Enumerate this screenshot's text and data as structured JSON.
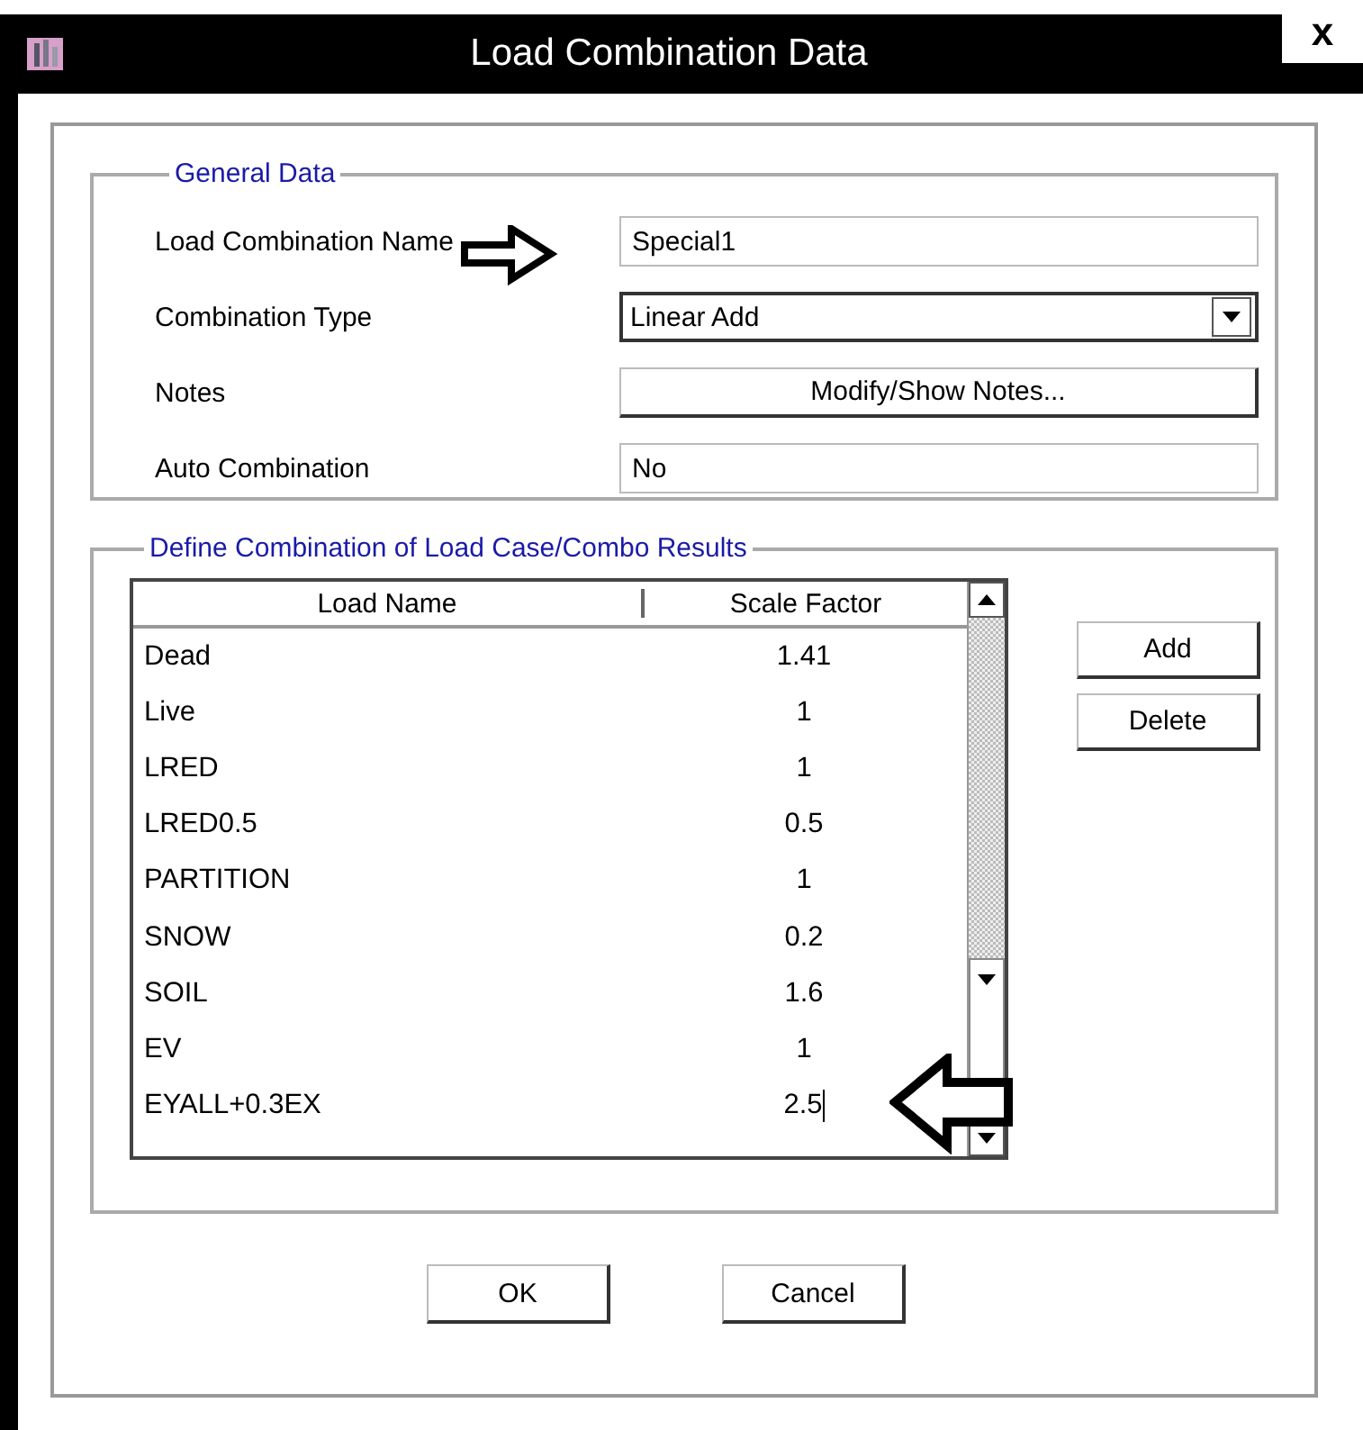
{
  "window": {
    "title": "Load Combination Data",
    "close": "x"
  },
  "general_data": {
    "legend": "General Data",
    "fields": [
      {
        "kind": "text",
        "label": "Load Combination Name",
        "value": "Special1",
        "annotated": true
      },
      {
        "kind": "dropdown",
        "label": "Combination Type",
        "value": "Linear Add",
        "annotated": false
      },
      {
        "kind": "button",
        "label": "Notes",
        "value": "Modify/Show Notes...",
        "annotated": false
      },
      {
        "kind": "readonly",
        "label": "Auto Combination",
        "value": "No",
        "annotated": false
      }
    ]
  },
  "combination": {
    "legend": "Define Combination of Load Case/Combo Results",
    "table": {
      "columns": [
        "Load Name",
        "Scale Factor"
      ],
      "rows": [
        {
          "load_name": "Dead",
          "scale_factor": "1.41",
          "editing": false
        },
        {
          "load_name": "Live",
          "scale_factor": "1",
          "editing": false
        },
        {
          "load_name": "LRED",
          "scale_factor": "1",
          "editing": false
        },
        {
          "load_name": "LRED0.5",
          "scale_factor": "0.5",
          "editing": false
        },
        {
          "load_name": "PARTITION",
          "scale_factor": "1",
          "editing": false
        },
        {
          "load_name": "SNOW",
          "scale_factor": "0.2",
          "editing": false
        },
        {
          "load_name": "SOIL",
          "scale_factor": "1.6",
          "editing": false
        },
        {
          "load_name": "EV",
          "scale_factor": "1",
          "editing": false
        },
        {
          "load_name": "EYALL+0.3EX",
          "scale_factor": "2.5",
          "editing": true
        }
      ]
    },
    "buttons": [
      "Add",
      "Delete"
    ]
  },
  "buttons": [
    "OK",
    "Cancel"
  ]
}
